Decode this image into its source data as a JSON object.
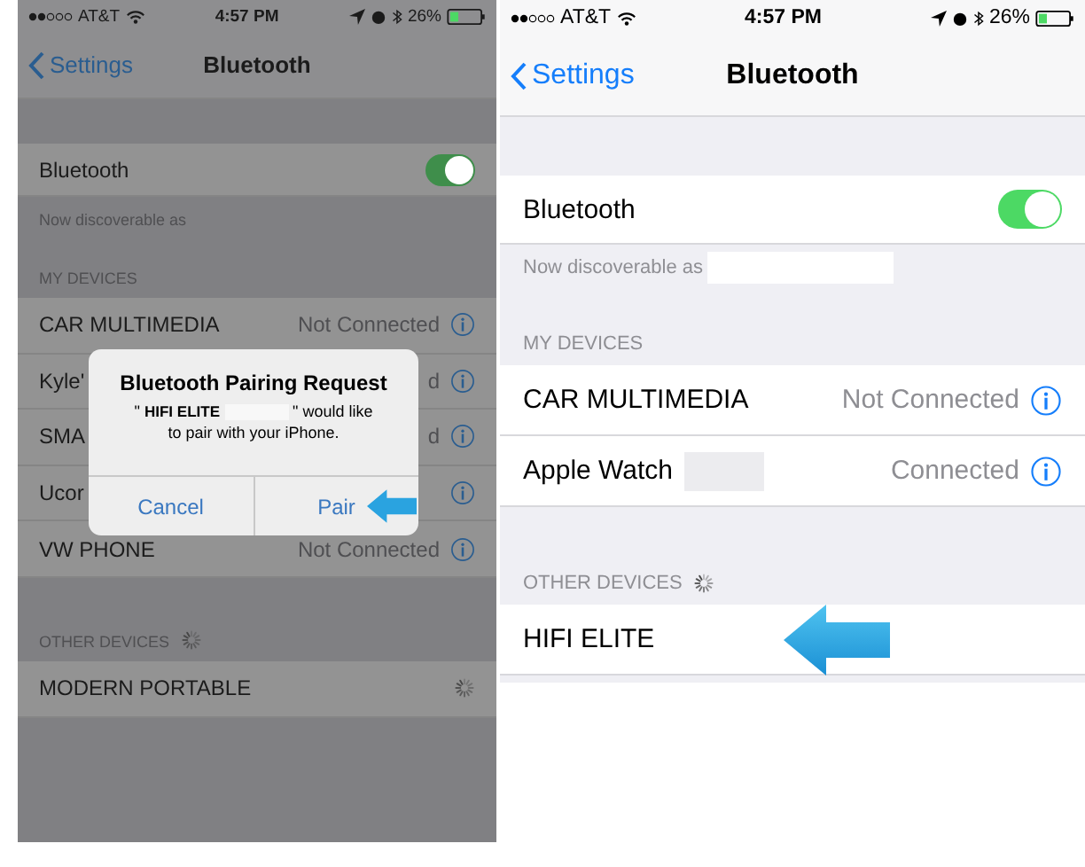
{
  "screens": [
    {
      "dimmed": true,
      "status_bar": {
        "carrier": "AT&T",
        "time": "4:57 PM",
        "battery": "26%"
      },
      "nav": {
        "back": "Settings",
        "title": "Bluetooth"
      },
      "bluetooth": {
        "label": "Bluetooth",
        "on": true
      },
      "discoverable": {
        "text": "Now discoverable as",
        "redacted": false
      },
      "sections": [
        {
          "header": "MY DEVICES",
          "searching": false,
          "rows": [
            {
              "name": "CAR MULTIMEDIA",
              "status": "Not Connected",
              "info": true,
              "redacted": false,
              "searching": false,
              "highlighted": false
            },
            {
              "name": "Kyle'",
              "status": "d",
              "info": true,
              "redacted": false,
              "searching": false,
              "highlighted": false
            },
            {
              "name": "SMA",
              "status": "d",
              "info": true,
              "redacted": false,
              "searching": false,
              "highlighted": false
            },
            {
              "name": "Ucor",
              "info": true,
              "redacted": false,
              "searching": false,
              "highlighted": false
            },
            {
              "name": "VW PHONE",
              "status": "Not Connected",
              "info": true,
              "redacted": false,
              "searching": false,
              "highlighted": false
            }
          ]
        },
        {
          "header": "OTHER DEVICES",
          "searching": true,
          "rows": [
            {
              "name": "MODERN PORTABLE",
              "info": false,
              "redacted": false,
              "searching": true,
              "highlighted": false
            }
          ]
        }
      ],
      "dialog": {
        "title": "Bluetooth Pairing Request",
        "quote": "\"",
        "device": "HIFI ELITE",
        "redacted": true,
        "message": "\" would like to pair with your iPhone.",
        "buttons": [
          {
            "label": "Cancel",
            "highlighted": false
          },
          {
            "label": "Pair",
            "highlighted": true
          }
        ]
      }
    },
    {
      "dimmed": false,
      "status_bar": {
        "carrier": "AT&T",
        "time": "4:57 PM",
        "battery": "26%"
      },
      "nav": {
        "back": "Settings",
        "title": "Bluetooth"
      },
      "bluetooth": {
        "label": "Bluetooth",
        "on": true
      },
      "discoverable": {
        "text": "Now discoverable as",
        "redacted": true
      },
      "sections": [
        {
          "header": "MY DEVICES",
          "searching": false,
          "rows": [
            {
              "name": "CAR MULTIMEDIA",
              "status": "Not Connected",
              "info": true,
              "redacted": false,
              "searching": false,
              "highlighted": false
            },
            {
              "name": "Apple Watch",
              "status": "Connected",
              "info": true,
              "redacted": true,
              "searching": false,
              "highlighted": false
            }
          ]
        },
        {
          "header": "OTHER DEVICES",
          "searching": true,
          "rows": [
            {
              "name": "HIFI ELITE",
              "info": false,
              "redacted": false,
              "searching": false,
              "highlighted": true
            }
          ]
        }
      ]
    }
  ]
}
